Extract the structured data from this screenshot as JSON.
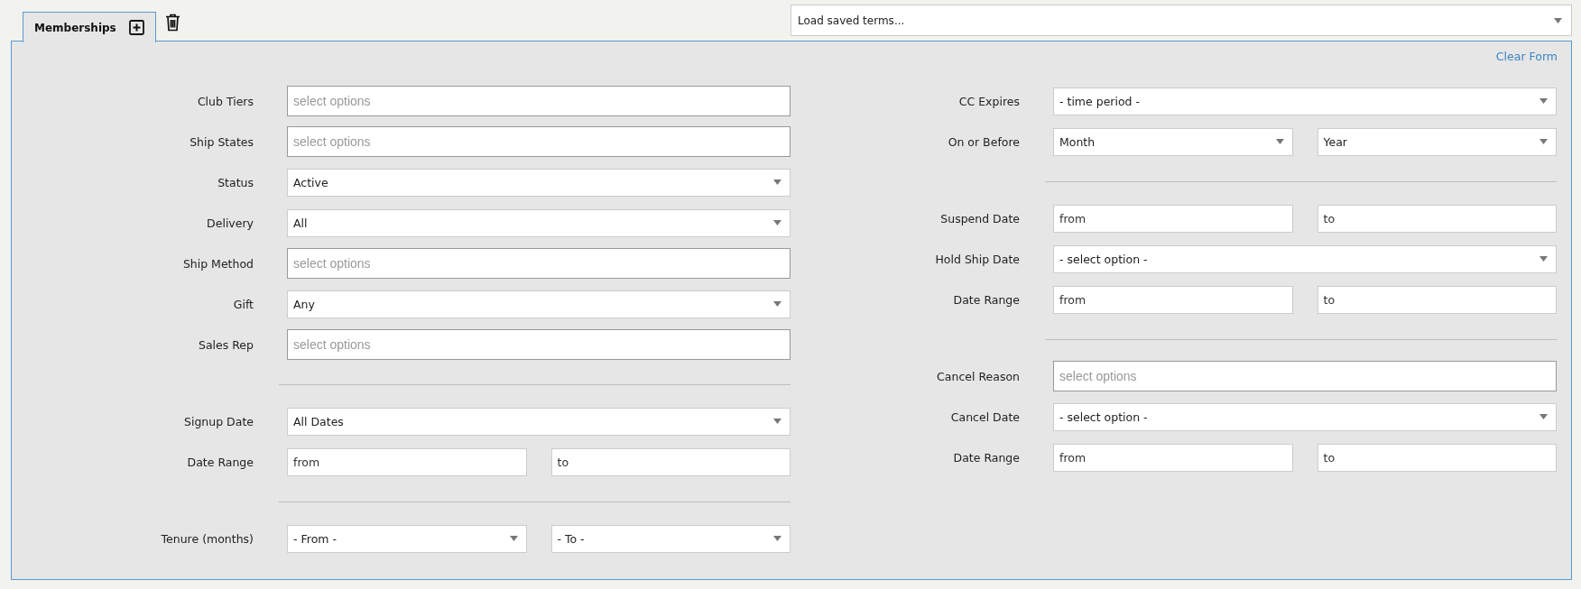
{
  "tabs": [
    {
      "label": "Memberships",
      "selected": true
    }
  ],
  "saved_terms": {
    "value": "Load saved terms..."
  },
  "clear_form": "Clear Form",
  "left_sections": [
    [
      {
        "label": "Club Tiers",
        "fields": [
          {
            "kind": "multiselect",
            "placeholder": "select options"
          }
        ]
      },
      {
        "label": "Ship States",
        "fields": [
          {
            "kind": "multiselect",
            "placeholder": "select options"
          }
        ]
      },
      {
        "label": "Status",
        "fields": [
          {
            "kind": "select",
            "value": "Active"
          }
        ]
      },
      {
        "label": "Delivery",
        "fields": [
          {
            "kind": "select",
            "value": "All"
          }
        ]
      },
      {
        "label": "Ship Method",
        "fields": [
          {
            "kind": "multiselect",
            "placeholder": "select options"
          }
        ]
      },
      {
        "label": "Gift",
        "fields": [
          {
            "kind": "select",
            "value": "Any"
          }
        ]
      },
      {
        "label": "Sales Rep",
        "fields": [
          {
            "kind": "multiselect",
            "placeholder": "select options"
          }
        ]
      }
    ],
    [
      {
        "label": "Signup Date",
        "fields": [
          {
            "kind": "select",
            "value": "All Dates"
          }
        ]
      },
      {
        "label": "Date Range",
        "fields": [
          {
            "kind": "text",
            "placeholder": "from"
          },
          {
            "kind": "text",
            "placeholder": "to"
          }
        ]
      }
    ],
    [
      {
        "label": "Tenure (months)",
        "fields": [
          {
            "kind": "select",
            "value": "- From -"
          },
          {
            "kind": "select",
            "value": "- To -"
          }
        ]
      }
    ]
  ],
  "right_sections": [
    [
      {
        "label": "CC Expires",
        "fields": [
          {
            "kind": "select",
            "value": "- time period -"
          }
        ]
      },
      {
        "label": "On or Before",
        "fields": [
          {
            "kind": "select",
            "value": "Month"
          },
          {
            "kind": "select",
            "value": "Year"
          }
        ]
      }
    ],
    [
      {
        "label": "Suspend Date",
        "fields": [
          {
            "kind": "text",
            "placeholder": "from"
          },
          {
            "kind": "text",
            "placeholder": "to"
          }
        ]
      },
      {
        "label": "Hold Ship Date",
        "fields": [
          {
            "kind": "select",
            "value": "- select option -"
          }
        ]
      },
      {
        "label": "Date Range",
        "fields": [
          {
            "kind": "text",
            "placeholder": "from"
          },
          {
            "kind": "text",
            "placeholder": "to"
          }
        ]
      }
    ],
    [
      {
        "label": "Cancel Reason",
        "fields": [
          {
            "kind": "multiselect",
            "placeholder": "select options"
          }
        ]
      },
      {
        "label": "Cancel Date",
        "fields": [
          {
            "kind": "select",
            "value": "- select option -"
          }
        ]
      },
      {
        "label": "Date Range",
        "fields": [
          {
            "kind": "text",
            "placeholder": "from"
          },
          {
            "kind": "text",
            "placeholder": "to"
          }
        ]
      }
    ]
  ]
}
